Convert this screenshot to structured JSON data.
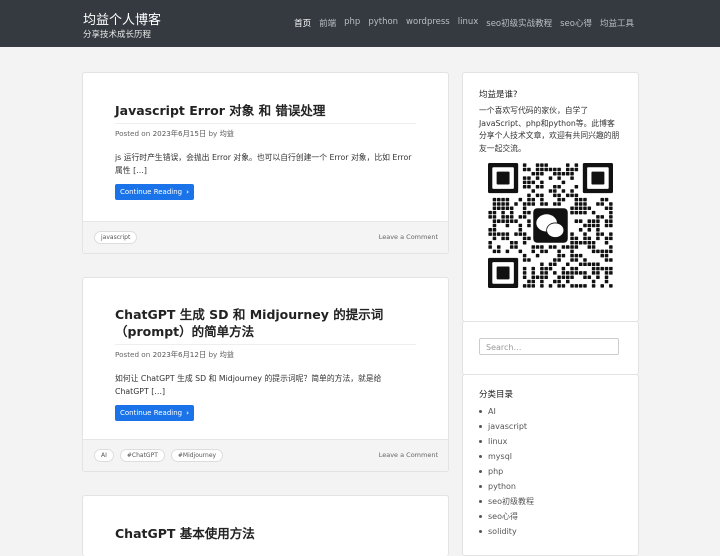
{
  "site": {
    "title": "均益个人博客",
    "tagline": "分享技术成长历程"
  },
  "nav": [
    "首页",
    "前端",
    "php",
    "python",
    "wordpress",
    "linux",
    "seo初级实战教程",
    "seo心得",
    "均益工具"
  ],
  "posts": [
    {
      "title": "Javascript Error 对象 和 错误处理",
      "meta_prefix": "Posted on",
      "date": "2023年6月15日",
      "by": "by",
      "author": "均益",
      "excerpt": "js 运行时产生错误，会抛出 Error 对象。也可以自行创建一个 Error 对象，比如 Error 属性 […]",
      "button": "Continue Reading",
      "tags": [
        "javascript"
      ],
      "comment": "Leave a Comment"
    },
    {
      "title": "ChatGPT 生成 SD 和 Midjourney 的提示词（prompt）的简单方法",
      "meta_prefix": "Posted on",
      "date": "2023年6月12日",
      "by": "by",
      "author": "均益",
      "excerpt": "如何让 ChatGPT 生成 SD 和 Midjourney 的提示词呢？简单的方法，就是给 ChatGPT […]",
      "button": "Continue Reading",
      "tags": [
        "AI",
        "#ChatGPT",
        "#Midjourney"
      ],
      "comment": "Leave a Comment"
    },
    {
      "title": "ChatGPT 基本使用方法"
    }
  ],
  "sidebar": {
    "about_title": "均益是谁?",
    "about_text": "一个喜欢写代码的家伙，自学了JavaScript、php和python等。此博客分享个人技术文章，欢迎有共同兴趣的朋友一起交流。",
    "qr_icon": "wechat-qr-code",
    "search_placeholder": "Search…",
    "categories_title": "分类目录",
    "categories": [
      "AI",
      "javascript",
      "linux",
      "mysql",
      "php",
      "python",
      "seo初级教程",
      "seo心得",
      "solidity"
    ]
  }
}
